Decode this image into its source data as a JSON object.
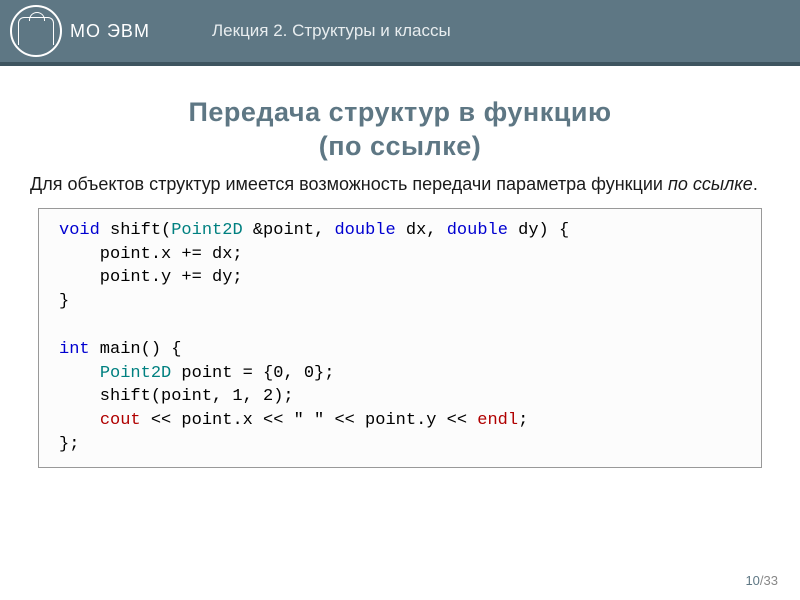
{
  "header": {
    "org": "МО ЭВМ",
    "lecture": "Лекция 2.  Структуры и классы"
  },
  "title": {
    "line1": "Передача структур в функцию",
    "line2": "(по ссылке)"
  },
  "desc": {
    "part1": "Для объектов структур имеется возможность передачи параметра функции ",
    "italic": "по ссылке",
    "part2": "."
  },
  "code": {
    "kw_void": "void",
    "fn_shift": " shift(",
    "type_p2d": "Point2D",
    "arg_point": " &point, ",
    "kw_double1": "double",
    "arg_dx": " dx, ",
    "kw_double2": "double",
    "arg_dy": " dy) {",
    "l2": "    point.x += dx;",
    "l3": "    point.y += dy;",
    "l4": "}",
    "blank": "",
    "kw_int": "int",
    "main_sig": " main() {",
    "l7a": "    ",
    "type_p2d2": "Point2D",
    "l7b": " point = {0, 0};",
    "l8": "    shift(point, 1, 2);",
    "l9a": "    ",
    "cout": "cout",
    "l9b": " << point.x << \" \" << point.y << ",
    "endl": "endl",
    "l9c": ";",
    "l10": "};"
  },
  "page": {
    "current": "10",
    "sep": "/",
    "total": "33"
  }
}
